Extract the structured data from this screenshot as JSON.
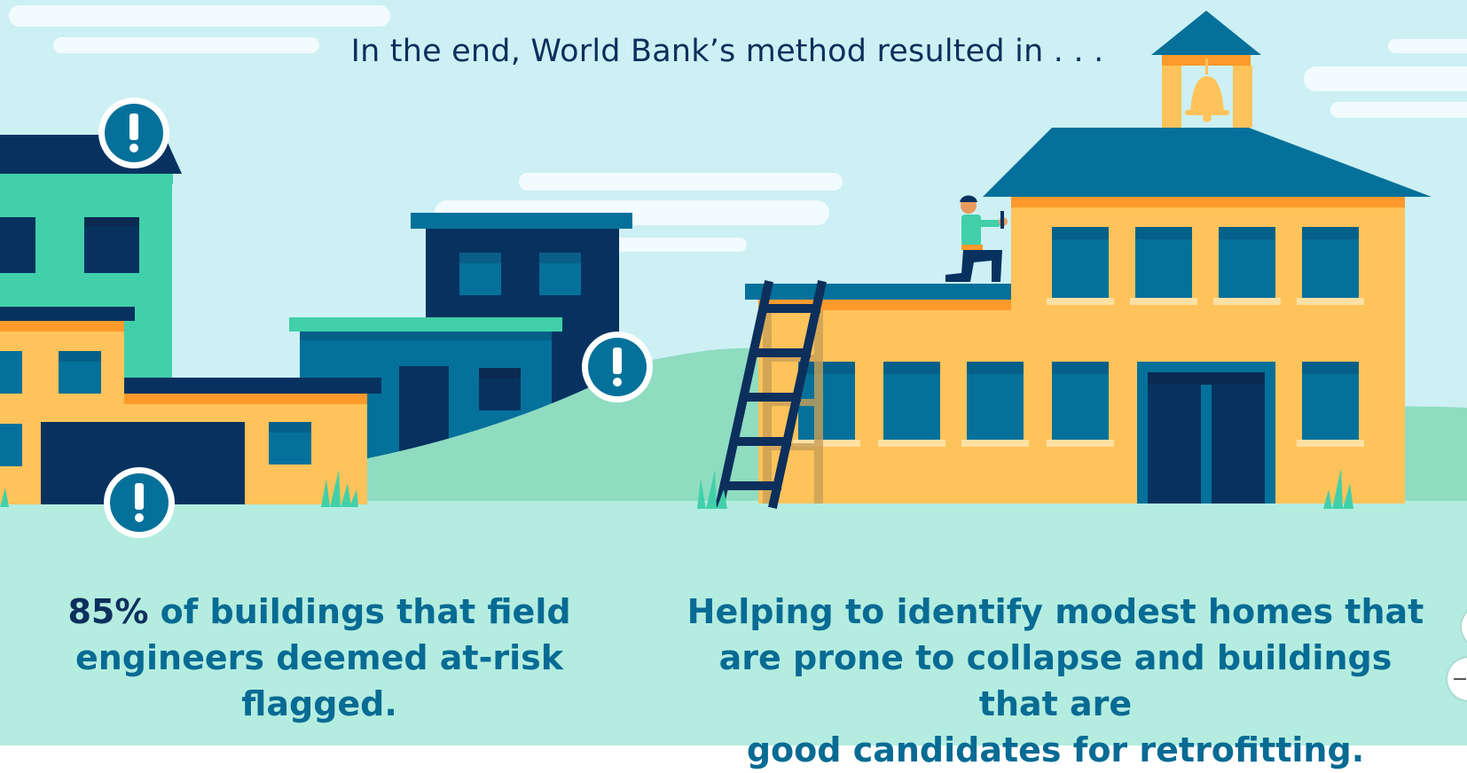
{
  "headline": "In the end, World Bank’s method resulted in . . .",
  "captions": {
    "left": {
      "stat": "85%",
      "line1_rest": " of buildings that field",
      "line2": "engineers deemed at-risk flagged."
    },
    "right": {
      "line1": "Helping to identify modest homes that",
      "line2": "are prone to collapse and buildings that are",
      "line3": "good candidates for retrofitting."
    }
  },
  "alert_marker_glyph": "!",
  "icons": [
    "exclamation-icon",
    "bell-icon",
    "ladder",
    "worker",
    "grass-icon"
  ],
  "colors": {
    "sky": "#cdf0f4",
    "hill": "#8fdcc1",
    "ground": "#b4ede0",
    "navy": "#073260",
    "teal": "#05719a",
    "mint": "#41d0a9",
    "yellow": "#fec35a",
    "orange": "#fd9a2b",
    "caption_text": "#076b93"
  }
}
